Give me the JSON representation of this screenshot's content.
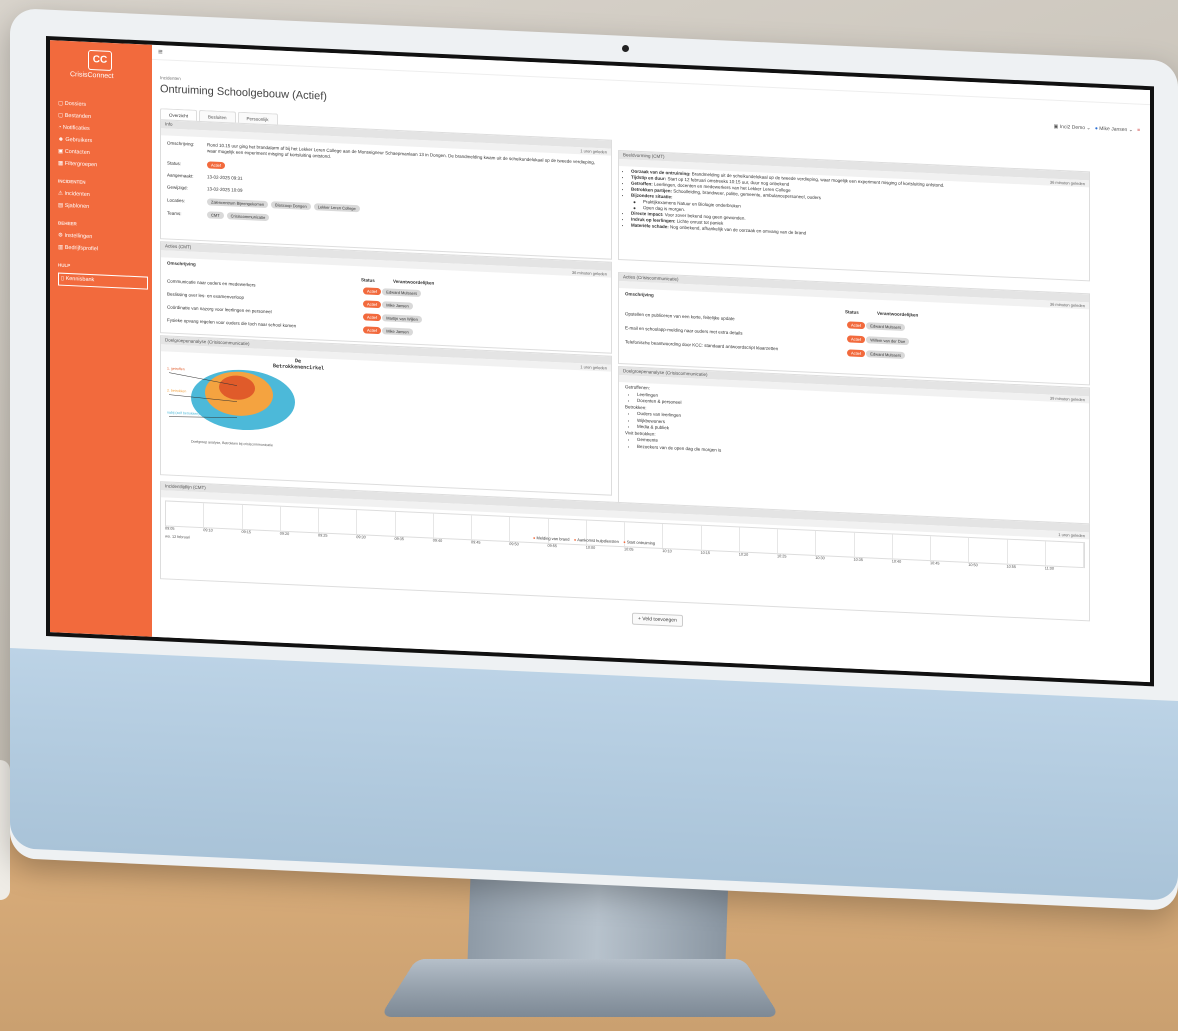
{
  "app": {
    "brand": "CrisisConnect",
    "logo_letters": "CC",
    "breadcrumb": "Incidenten",
    "title": "Ontruiming Schoolgebouw (Actief)",
    "org_menu": "Inci2 Demo",
    "user_menu": "Mike Jansen",
    "accent": "#f26a3d"
  },
  "sidebar": {
    "items_top": [
      {
        "label": "Dossiers",
        "icon": "folder-icon"
      },
      {
        "label": "Bestanden",
        "icon": "file-icon"
      },
      {
        "label": "Notificaties",
        "icon": "bell-icon"
      },
      {
        "label": "Gebruikers",
        "icon": "users-icon"
      },
      {
        "label": "Contacten",
        "icon": "contacts-icon"
      },
      {
        "label": "Filtergroepen",
        "icon": "filter-icon"
      }
    ],
    "incidents_head": "INCIDENTEN",
    "items_incidents": [
      {
        "label": "Incidenten",
        "icon": "warning-icon"
      },
      {
        "label": "Sjablonen",
        "icon": "template-icon"
      }
    ],
    "beheer_head": "BEHEER",
    "items_beheer": [
      {
        "label": "Instellingen",
        "icon": "settings-icon"
      },
      {
        "label": "Bedrijfsprofiel",
        "icon": "building-icon"
      }
    ],
    "help_head": "HULP",
    "items_help": [
      {
        "label": "Kennisbank",
        "icon": "book-icon"
      }
    ]
  },
  "tabs": [
    "Overzicht",
    "Besluiten",
    "Persoonlijk"
  ],
  "info": {
    "header": "Info",
    "sub": "1 uren geleden",
    "labels": {
      "description": "Omschrijving:",
      "status": "Status:",
      "created": "Aangemaakt:",
      "modified": "Gewijzigd:",
      "locations": "Locaties:",
      "teams": "Teams:"
    },
    "description": "Rond 10.15 uur ging het brandalarm af bij het Lekker Leren College aan de Monseigneur Schaepmanlaan 13 in Dongen. De brandmelding kwam uit de scheikundelokaal op de tweede verdieping, waar mogelijk een experiment misging of kortsluiting ontstond.",
    "status": "Actief",
    "created": "13-02-2025 09:31",
    "modified": "13-02-2025 10:09",
    "locations": [
      "Zalencentrum Bijeengekomen",
      "Bioscoop Dongen",
      "Lekker Leren College"
    ],
    "teams": [
      "CMT",
      "Crisiscommunicatie"
    ]
  },
  "assessment": {
    "header": "Beeldvorming (CMT)",
    "sub": "36 minuten geleden",
    "lines": [
      {
        "bold": "Oorzaak van de ontruiming:",
        "text": "Brandmelding uit de scheikundelokaal op de tweede verdieping, waar mogelijk een experiment misging of kortsluiting ontstond."
      },
      {
        "bold": "Tijdstip en duur:",
        "text": "Start op 12 februari omstreeks 10:15 uur, duur nog onbekend"
      },
      {
        "bold": "Getroffen:",
        "text": "Leerlingen, docenten en medewerkers van het Lekker Leren College"
      },
      {
        "bold": "Betrokken partijen:",
        "text": "Schoolleiding, brandweer, politie, gemeente, ambulancepersoneel, ouders"
      },
      {
        "bold": "Bijzondere situatie:",
        "text": ""
      }
    ],
    "sub_items": [
      "Praktijkexamens Natuur en Biologie onderbroken",
      "Open dag is morgen."
    ],
    "lines2": [
      {
        "bold": "Directe impact:",
        "text": "Voor zover bekend nog geen gewonden."
      },
      {
        "bold": "Indruk op leerlingen:",
        "text": "Lichte onrust tot paniek"
      },
      {
        "bold": "Materiële schade:",
        "text": "Nog onbekend, afhankelijk van de oorzaak en omvang van de brand"
      }
    ]
  },
  "actions_cmt": {
    "header": "Acties (CMT)",
    "sub": "36 minuten geleden",
    "col_desc": "Omschrijving",
    "col_status": "Status",
    "col_owner": "Verantwoordelijken",
    "rows": [
      {
        "desc": "Communicatie naar ouders en medewerkers",
        "status": "Actief",
        "owner": "Edward Mulsaers"
      },
      {
        "desc": "Beslissing over les- en examenverloop",
        "status": "Actief",
        "owner": "Mike Jansen"
      },
      {
        "desc": "Coördinatie van nazorg voor leerlingen en personeel",
        "status": "Actief",
        "owner": "Martijn van Wijlen"
      },
      {
        "desc": "Fysieke opvang regelen voor ouders die toch naar school komen",
        "status": "Actief",
        "owner": "Mike Jansen"
      }
    ]
  },
  "actions_comm": {
    "header": "Acties (Crisiscommunicatie)",
    "sub": "36 minuten geleden",
    "col_desc": "Omschrijving",
    "col_status": "Status",
    "col_owner": "Verantwoordelijken",
    "rows": [
      {
        "desc": "Opstellen en publiceren van een korte, feitelijke update",
        "status": "Actief",
        "owner": "Edward Mulsaers"
      },
      {
        "desc": "E-mail en schoolapp-melding naar ouders met extra details",
        "status": "Actief",
        "owner": "Willem van der Doe"
      },
      {
        "desc": "Telefonische beantwoording door KCC: standaard antwoordscript klaarzetten",
        "status": "Actief",
        "owner": "Edward Mulsaers"
      }
    ]
  },
  "target_left": {
    "header": "Doelgroepenanalyse (Crisiscommunicatie)",
    "sub": "1 uren geleden",
    "diagram_title": "De Betrokkenencirkel",
    "ring_labels": [
      "1. getroffen",
      "2. betrokken",
      "nabij (zelf betrokken)"
    ],
    "caption": "Doelgroep analyse, Betrokken bij crisiscommunicatie"
  },
  "target_right": {
    "header": "Doelgroepenanalyse (Crisiscommunicatie)",
    "sub": "39 minuten geleden",
    "group1": "Getroffenen:",
    "group1_items": [
      "Leerlingen",
      "Docenten & personeel"
    ],
    "group2": "Betrokken:",
    "group2_items": [
      "Ouders van leerlingen",
      "Wijkbewoners",
      "Media & publiek"
    ],
    "group3": "Vivit betrokken:",
    "group3_items": [
      "Gemeente",
      "Bezoekers van de open dag die morgen is"
    ]
  },
  "timeline": {
    "header": "Incidentlijdlijn (CMT)",
    "sub": "1 uren geleden",
    "date_label": "wo. 12 februari",
    "times": [
      "09:05",
      "09:10",
      "09:15",
      "09:20",
      "09:25",
      "09:30",
      "09:35",
      "09:40",
      "09:45",
      "09:50",
      "09:55",
      "10:00",
      "10:05",
      "10:10",
      "10:15",
      "10:20",
      "10:25",
      "10:30",
      "10:35",
      "10:40",
      "10:45",
      "10:50",
      "10:55",
      "11:00"
    ],
    "legend": [
      "Melding van brand",
      "Aankomst hulpdiensten",
      "Start ontruiming"
    ]
  },
  "add_button": "+ Veld toevoegen"
}
